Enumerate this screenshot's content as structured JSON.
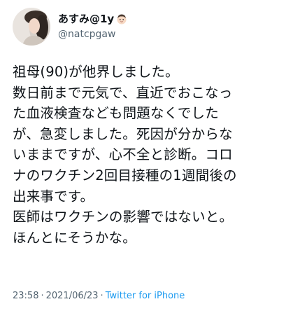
{
  "author": {
    "display_name": "あすみ@1y",
    "name_emoji_icon": "baby-face-icon",
    "handle": "@natcpgaw",
    "avatar_icon": "profile-photo-avatar"
  },
  "tweet": {
    "lines": [
      "祖母(90)が他界しました。",
      "数日前まで元気で、直近でおこなっ",
      "た血液検査なども問題なくでした",
      "が、急変しました。死因が分からな",
      "いままですが、心不全と診断。コロ",
      "ナのワクチン2回目接種の1週間後の",
      "出来事です。",
      "医師はワクチンの影響ではないと。",
      "ほんとにそうかな。"
    ]
  },
  "meta": {
    "time": "23:58",
    "separator": "·",
    "date": "2021/06/23",
    "source": "Twitter for iPhone"
  },
  "colors": {
    "text": "#0f1419",
    "secondary": "#536471",
    "link": "#1d9bf0"
  }
}
